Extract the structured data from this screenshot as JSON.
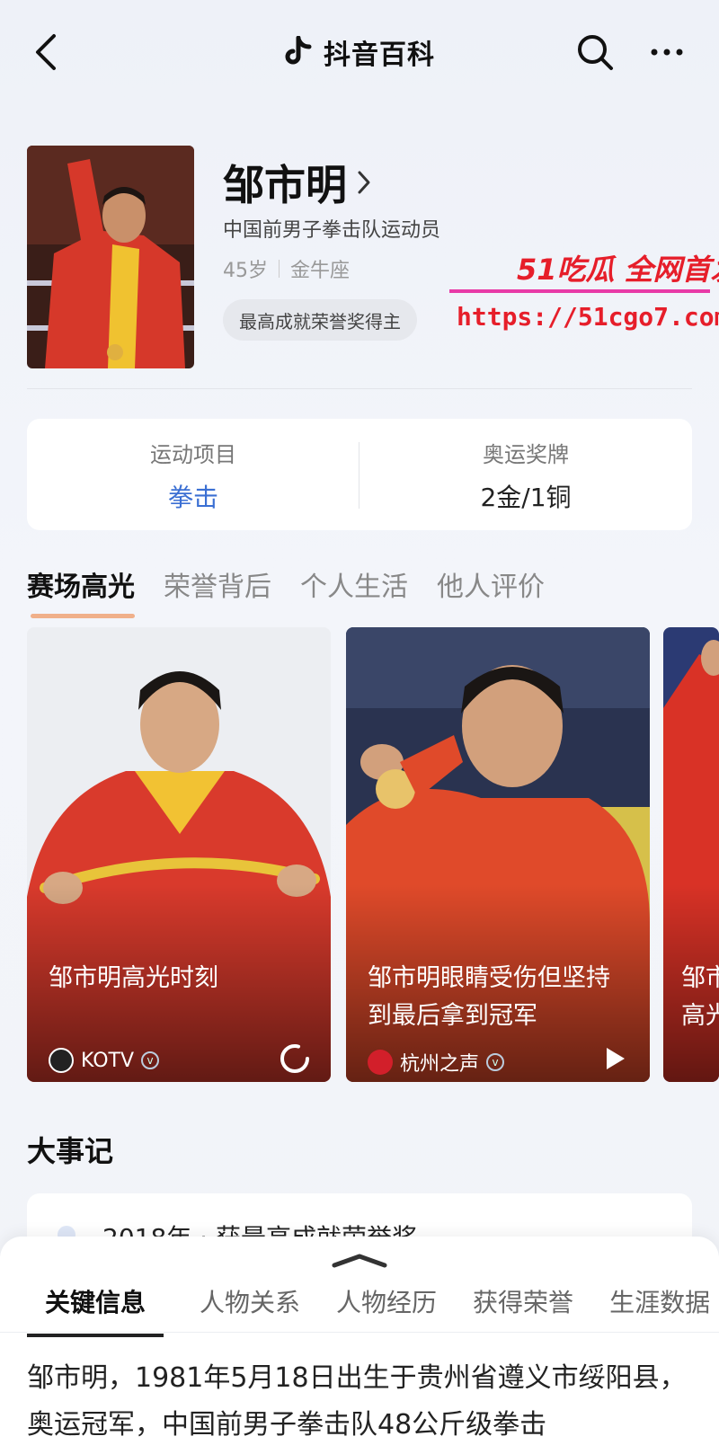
{
  "header": {
    "brand_title": "抖音百科",
    "icons": [
      "back-icon",
      "tiktok-logo-icon",
      "search-icon",
      "more-icon"
    ]
  },
  "profile": {
    "name": "邹市明",
    "subtitle": "中国前男子拳击队运动员",
    "age": "45岁",
    "zodiac": "金牛座",
    "badge": "最高成就荣誉奖得主"
  },
  "watermark": {
    "line1": "51吃瓜 全网首发",
    "line2": "https://51cgo7.com"
  },
  "stats": [
    {
      "label": "运动项目",
      "value": "拳击"
    },
    {
      "label": "奥运奖牌",
      "value": "2金/1铜"
    }
  ],
  "tabs": [
    "赛场高光",
    "荣誉背后",
    "个人生活",
    "他人评价"
  ],
  "videos": [
    {
      "title": "邹市明高光时刻",
      "source": "KOTV",
      "status_icon": "loading-icon"
    },
    {
      "title": "邹市明眼睛受伤但坚持到最后拿到冠军",
      "source": "杭州之声",
      "status_icon": "play-icon"
    },
    {
      "title": "邹市高光",
      "source": ""
    }
  ],
  "chronicle": {
    "title": "大事记",
    "first_event": "2018年 · 获最高成就荣誉奖"
  },
  "sheet": {
    "tabs": [
      "关键信息",
      "人物关系",
      "人物经历",
      "获得荣誉",
      "生涯数据"
    ],
    "paragraph": "邹市明，1981年5月18日出生于贵州省遵义市绥阳县，奥运冠军，中国前男子拳击队48公斤级拳击"
  },
  "colors": {
    "accent_blue": "#3b6fd3",
    "tab_underline": "#f0b08a",
    "watermark_red": "#e61e2a"
  }
}
